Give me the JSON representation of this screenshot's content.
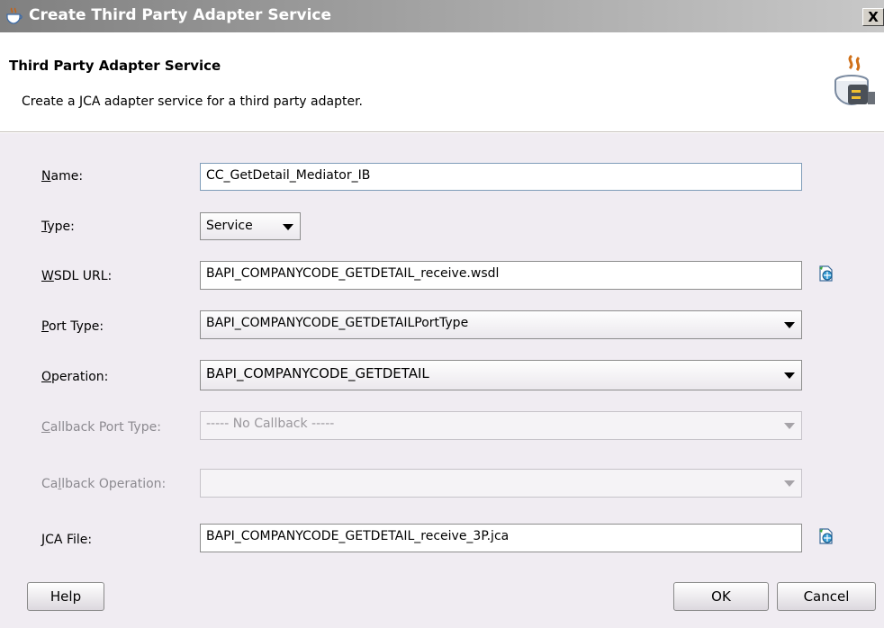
{
  "window": {
    "title": "Create Third Party Adapter Service",
    "close_label": "X"
  },
  "header": {
    "title": "Third Party Adapter Service",
    "description": "Create a JCA adapter service for a third party adapter."
  },
  "form": {
    "name": {
      "label": "Name:",
      "mnemonic": "N",
      "value": "CC_GetDetail_Mediator_IB"
    },
    "type": {
      "label": "Type:",
      "mnemonic": "T",
      "value": "Service"
    },
    "wsdl_url": {
      "label": "WSDL URL:",
      "mnemonic": "W",
      "value": "BAPI_COMPANYCODE_GETDETAIL_receive.wsdl"
    },
    "port_type": {
      "label": "Port Type:",
      "mnemonic": "P",
      "value": "BAPI_COMPANYCODE_GETDETAILPortType"
    },
    "operation": {
      "label": "Operation:",
      "mnemonic": "O",
      "value": "BAPI_COMPANYCODE_GETDETAIL"
    },
    "callback_port_type": {
      "label": "Callback Port Type:",
      "mnemonic": "C",
      "value": "----- No Callback -----",
      "enabled": false
    },
    "callback_operation": {
      "label": "Callback Operation:",
      "mnemonic": "l",
      "value": "",
      "enabled": false
    },
    "jca_file": {
      "label": "JCA File:",
      "mnemonic": "J",
      "value": "BAPI_COMPANYCODE_GETDETAIL_receive_3P.jca"
    }
  },
  "buttons": {
    "help": "Help",
    "ok": "OK",
    "cancel": "Cancel"
  },
  "icons": {
    "title": "coffee-cup-icon",
    "header": "adapter-plug-icon",
    "wsdl_browse": "browse-wizard-icon",
    "jca_browse": "browse-wizard-icon"
  }
}
